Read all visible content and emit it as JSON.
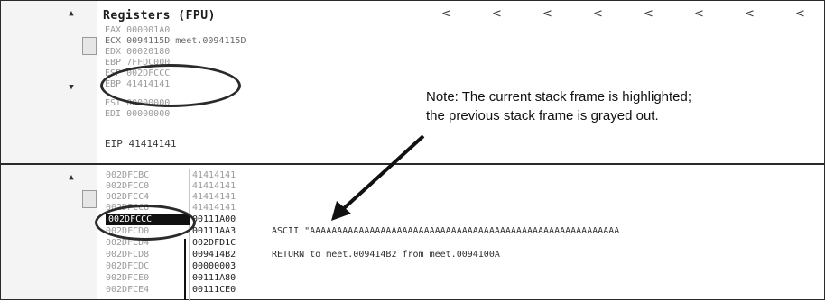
{
  "registers_pane": {
    "title": "Registers (FPU)",
    "lines": [
      "EAX 000001A0",
      "ECX 0094115D meet.0094115D",
      "EDX 00020180",
      "EBP 7FFDC000",
      "ESP 002DFCCC",
      "EBP 41414141",
      "ESI 00000000",
      "EDI 00000000"
    ],
    "eip": "EIP 41414141"
  },
  "annotation": {
    "note": "Note: The current stack frame is highlighted;\nthe previous stack frame is grayed out."
  },
  "stack_pane": {
    "rows": [
      {
        "addr": "002DFCBC",
        "value": "41414141",
        "comment": ""
      },
      {
        "addr": "002DFCC0",
        "value": "41414141",
        "comment": ""
      },
      {
        "addr": "002DFCC4",
        "value": "41414141",
        "comment": ""
      },
      {
        "addr": "002DFCC8",
        "value": "41414141",
        "comment": ""
      },
      {
        "addr": "002DFCCC",
        "value": "00111A00",
        "comment": ""
      },
      {
        "addr": "002DFCD0",
        "value": "00111AA3",
        "comment": "ASCII \"AAAAAAAAAAAAAAAAAAAAAAAAAAAAAAAAAAAAAAAAAAAAAAAAAAAAAAAAA"
      },
      {
        "addr": "002DFCD4",
        "value": "002DFD1C",
        "comment": ""
      },
      {
        "addr": "002DFCD8",
        "value": "009414B2",
        "comment": "RETURN to meet.009414B2 from meet.0094100A"
      },
      {
        "addr": "002DFCDC",
        "value": "00000003",
        "comment": ""
      },
      {
        "addr": "002DFCE0",
        "value": "00111A80",
        "comment": ""
      },
      {
        "addr": "002DFCE4",
        "value": "00111CE0",
        "comment": ""
      }
    ],
    "selected_addr": "002DFCCC"
  }
}
